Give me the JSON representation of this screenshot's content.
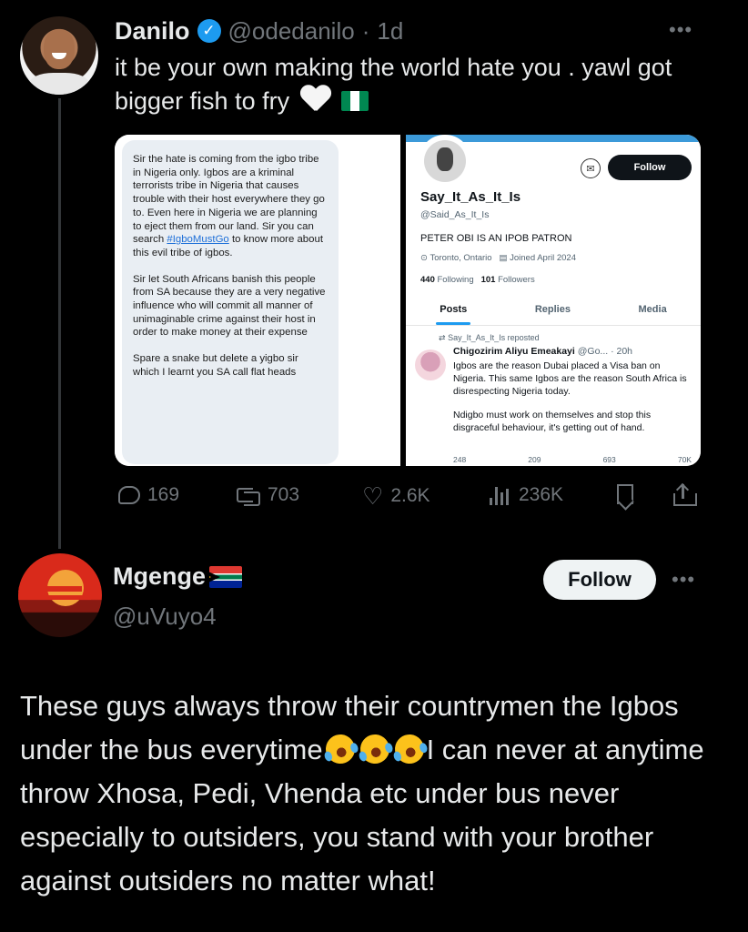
{
  "tweet1": {
    "name": "Danilo",
    "handle": "@odedanilo",
    "separator": "·",
    "time": "1d",
    "text": "it be your own making the world hate you . yawl got bigger fish to fry",
    "emojis": [
      "white-heart",
      "nigeria-flag"
    ],
    "media": {
      "left_paragraphs": [
        "Sir the hate is coming from the igbo tribe in Nigeria only. Igbos are a kriminal terrorists tribe in Nigeria that causes trouble with their host everywhere they go to. Even here in Nigeria we are planning to eject them from our land. Sir you can search",
        "to know more about this evil tribe of igbos.",
        "Sir let South Africans banish this people from SA because they are a very negative influence who will commit all manner of unimaginable crime against their host in order to make money at their expense",
        "Spare a snake but delete a yigbo sir which I learnt you SA call flat heads"
      ],
      "hashtag": "#IgboMustGo",
      "profile": {
        "follow_label": "Follow",
        "name": "Say_It_As_It_Is",
        "handle": "@Said_As_It_Is",
        "bio": "PETER OBI IS AN IPOB PATRON",
        "location": "Toronto, Ontario",
        "joined": "Joined April 2024",
        "following_count": "440",
        "following_label": "Following",
        "followers_count": "101",
        "followers_label": "Followers",
        "tabs": [
          "Posts",
          "Replies",
          "Media"
        ],
        "repost_label": "Say_It_As_It_Is reposted",
        "inner_tweet": {
          "name": "Chigozirim Aliyu Emeakayi",
          "handle_time": "@Go... · 20h",
          "paragraphs": [
            "Igbos are the reason Dubai placed a Visa ban on Nigeria. This same Igbos are the reason South Africa is disrespecting Nigeria today.",
            "Ndigbo must work on themselves and stop this disgraceful behaviour, it's getting out of hand."
          ],
          "actions": [
            "248",
            "209",
            "693",
            "70K"
          ]
        }
      }
    },
    "stats": {
      "replies": "169",
      "retweets": "703",
      "likes": "2.6K",
      "views": "236K"
    }
  },
  "tweet2": {
    "name": "Mgenge",
    "handle": "@uVuyo4",
    "follow_label": "Follow",
    "emojis": [
      "south-africa-flag",
      "rolling-laughing-face"
    ],
    "text_before": "These guys always throw their countrymen the Igbos under the bus everytime",
    "text_after": "I can never at anytime throw Xhosa, Pedi, Vhenda etc under bus never especially to outsiders, you stand with your brother against outsiders no matter what!"
  },
  "colors": {
    "background": "#000000",
    "text": "#e7e9ea",
    "muted": "#71767b",
    "verified": "#1d9bf0",
    "follow_button_bg": "#eff3f4"
  }
}
